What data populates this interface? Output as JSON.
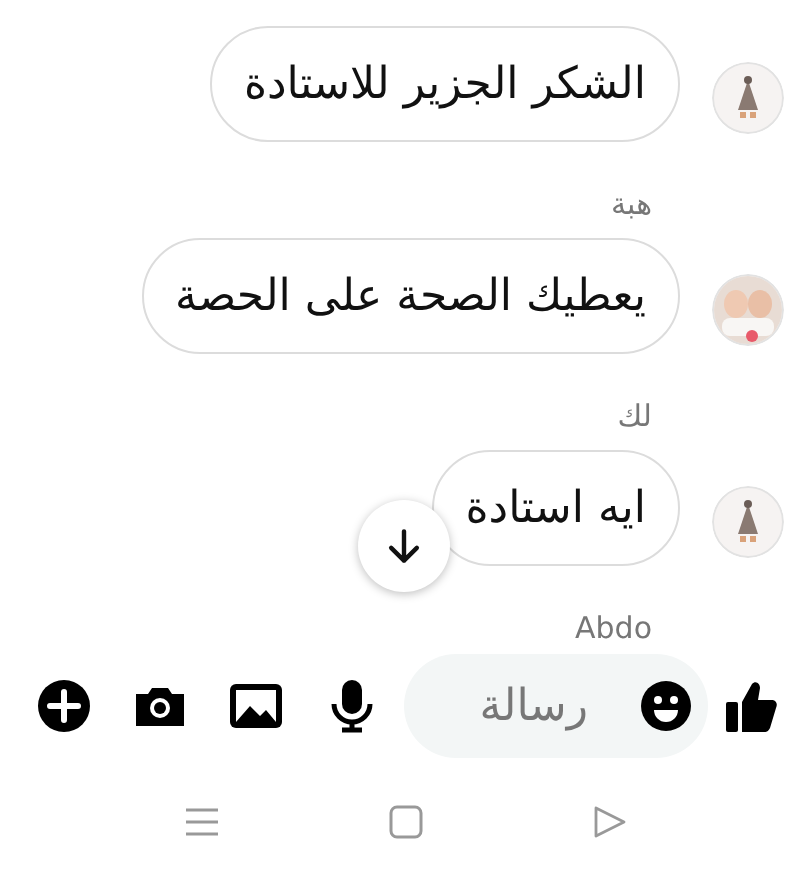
{
  "conversation": [
    {
      "kind": "message",
      "text": "الشكر الجزير للاستادة"
    },
    {
      "kind": "sender",
      "text": "هبة"
    },
    {
      "kind": "message",
      "text": "يعطيك الصحة على الحصة"
    },
    {
      "kind": "sender",
      "text": "لك"
    },
    {
      "kind": "message",
      "text": "ايه  استادة"
    },
    {
      "kind": "sender",
      "text": "Abdo"
    }
  ],
  "composer": {
    "placeholder": "رسالة"
  }
}
